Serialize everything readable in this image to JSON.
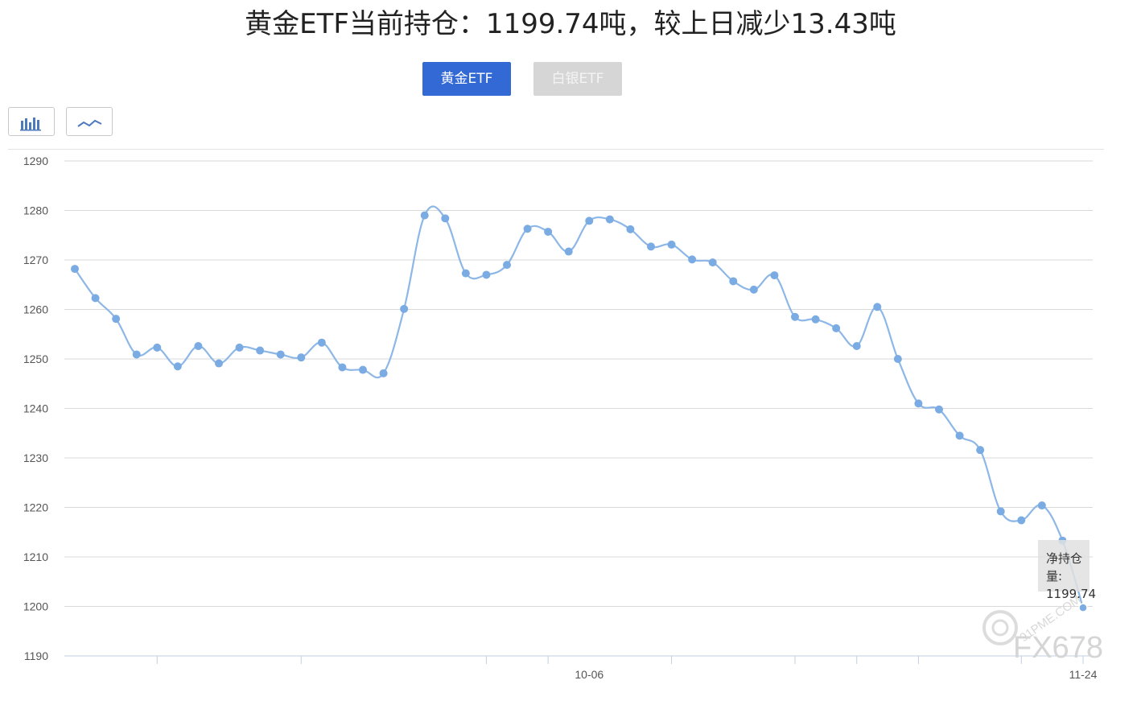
{
  "header": {
    "title": "黄金ETF当前持仓：1199.74吨，较上日减少13.43吨"
  },
  "tabs": [
    {
      "label": "黄金ETF",
      "active": true
    },
    {
      "label": "白银ETF",
      "active": false
    }
  ],
  "chart_type_buttons": [
    {
      "icon": "bar-chart-icon"
    },
    {
      "icon": "line-chart-icon"
    }
  ],
  "tooltip": {
    "label": "净持仓量:",
    "value": "1199.74"
  },
  "watermark": {
    "text": "FX678",
    "subtext": "91PME.COM"
  },
  "colors": {
    "accent": "#3269d4",
    "line": "#8db7e6",
    "point": "#7aabe2",
    "grid": "#d9d9d9"
  },
  "chart_data": {
    "type": "line",
    "title": "",
    "xlabel": "",
    "ylabel": "",
    "ylim": [
      1190,
      1290
    ],
    "yticks": [
      1190,
      1200,
      1210,
      1220,
      1230,
      1240,
      1250,
      1260,
      1270,
      1280,
      1290
    ],
    "x_tick_labels": [
      "10-06",
      "11-24"
    ],
    "grid": true,
    "legend": "none",
    "series": [
      {
        "name": "净持仓量",
        "values": [
          1268.2,
          1262.3,
          1258.1,
          1250.9,
          1252.3,
          1248.5,
          1252.6,
          1249.1,
          1252.3,
          1251.7,
          1250.9,
          1250.3,
          1253.3,
          1248.3,
          1247.8,
          1247.1,
          1260.1,
          1279.0,
          1278.4,
          1267.3,
          1267.0,
          1269.0,
          1276.3,
          1275.7,
          1271.7,
          1277.9,
          1278.2,
          1276.2,
          1272.7,
          1273.1,
          1270.1,
          1269.5,
          1265.7,
          1264.0,
          1266.9,
          1258.5,
          1258.0,
          1256.2,
          1252.6,
          1260.5,
          1250.0,
          1241.0,
          1239.8,
          1234.5,
          1231.6,
          1219.2,
          1217.4,
          1220.4,
          1213.3,
          1199.74
        ]
      }
    ]
  }
}
